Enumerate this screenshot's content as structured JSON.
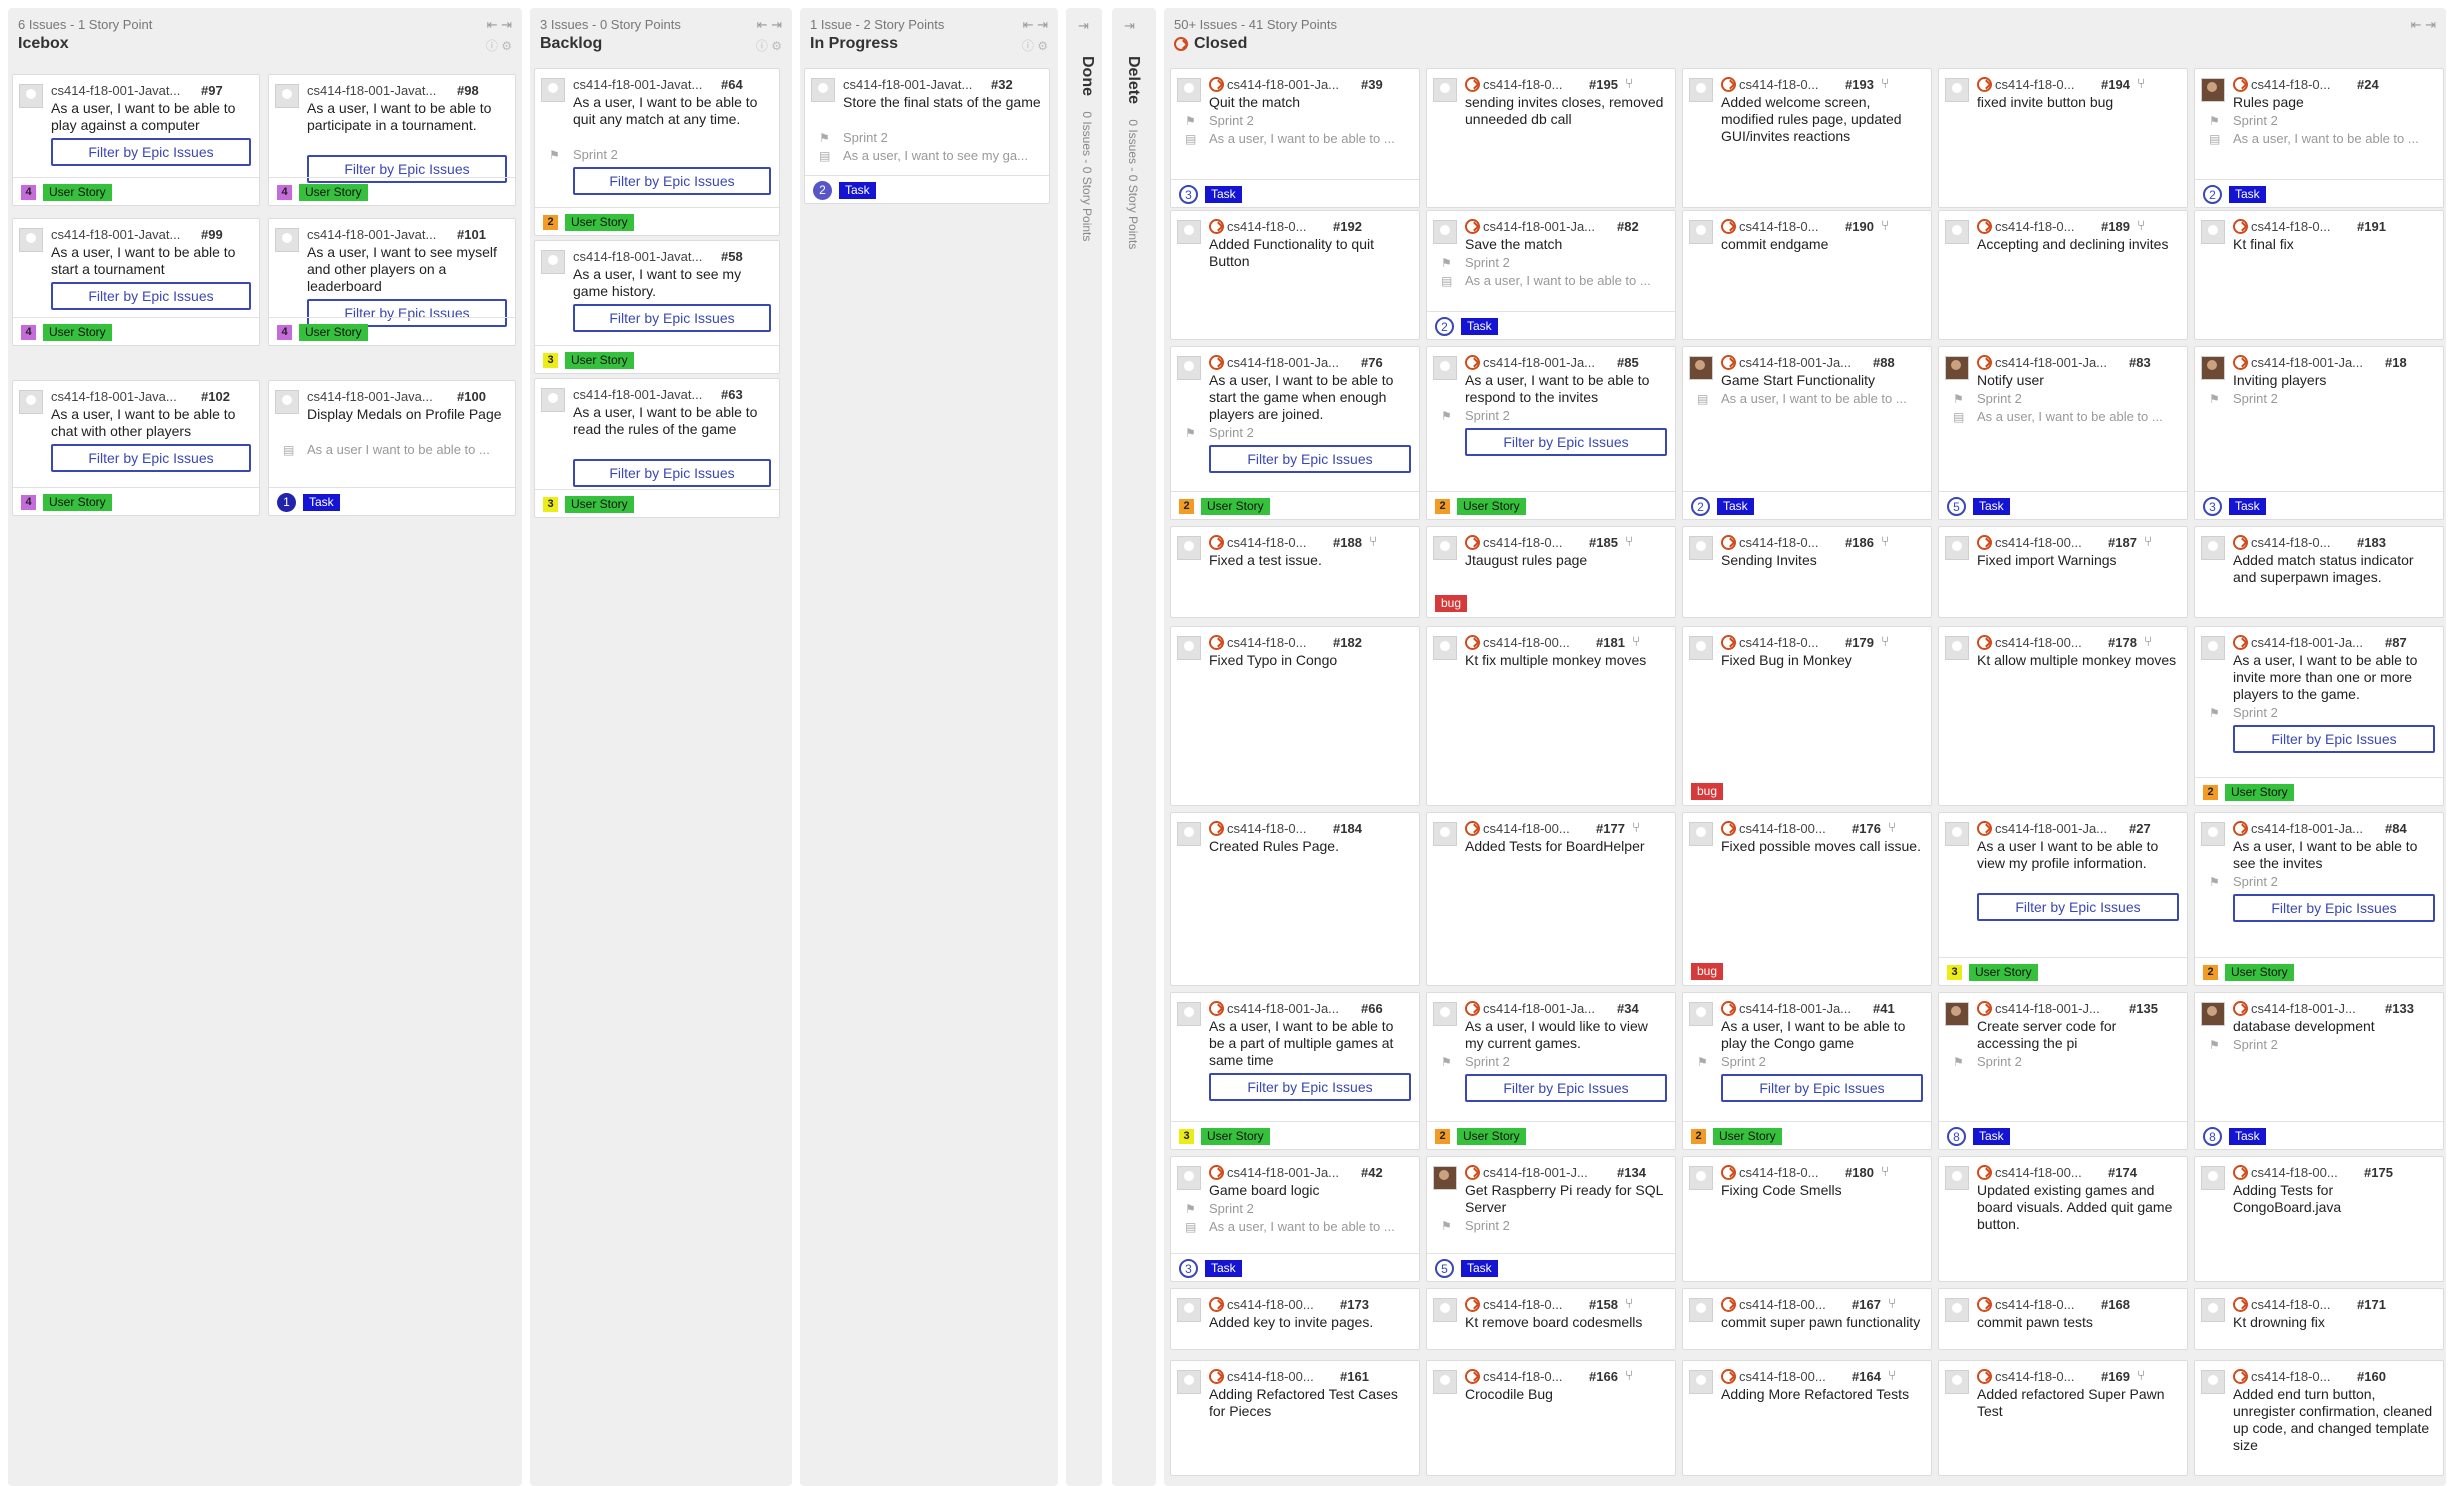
{
  "colors": {
    "user_story": "#35c13c",
    "task": "#1414d2",
    "bug": "#d73a3a",
    "est_purple": "#c56bdc",
    "est_orange": "#f29b25",
    "est_yellow": "#ecec19",
    "closed_icon": "#d04a1a",
    "epic_border": "#3a48b3"
  },
  "labels": {
    "user_story": "User Story",
    "task": "Task",
    "bug": "bug",
    "epic_btn": "Filter by Epic Issues",
    "sprint": "Sprint 2"
  },
  "icons": {
    "collapse": "collapse-icon",
    "expand": "expand-icon",
    "info": "info-icon",
    "settings": "gear-icon",
    "closed": "closed-issue-icon",
    "pull_request": "pull-request-icon",
    "milestone": "milestone-icon",
    "epic": "epic-icon"
  },
  "pipelines": [
    {
      "name": "Icebox",
      "meta": "6 Issues - 1 Story Point"
    },
    {
      "name": "Backlog",
      "meta": "3 Issues - 0 Story Points"
    },
    {
      "name": "In Progress",
      "meta": "1 Issue - 2 Story Points"
    },
    {
      "name": "Done",
      "meta": "0 Issues - 0 Story Points"
    },
    {
      "name": "Delete",
      "meta": "0 Issues - 0 Story Points"
    },
    {
      "name": "Closed",
      "meta": "50+ Issues - 41 Story Points"
    }
  ],
  "cards": [
    {
      "repo": "cs414-f18-001-Javat...",
      "num": "#97",
      "title": "As a user, I want to be able to play against a computer",
      "est": "4",
      "label": "User Story"
    },
    {
      "repo": "cs414-f18-001-Javat...",
      "num": "#98",
      "title": "As a user, I want to be able to participate in a tournament.",
      "est": "4",
      "label": "User Story"
    },
    {
      "repo": "cs414-f18-001-Javat...",
      "num": "#99",
      "title": "As a user, I want to be able to start a tournament",
      "est": "4",
      "label": "User Story"
    },
    {
      "repo": "cs414-f18-001-Javat...",
      "num": "#101",
      "title": "As a user, I want to see myself and other players on a leaderboard",
      "est": "4",
      "label": "User Story"
    },
    {
      "repo": "cs414-f18-001-Java...",
      "num": "#102",
      "title": "As a user, I want to be able to chat with other players",
      "est": "4",
      "label": "User Story"
    },
    {
      "repo": "cs414-f18-001-Java...",
      "num": "#100",
      "title": "Display Medals on Profile Page",
      "epicline": "As a user I want to be able to ...",
      "est": "1",
      "label": "Task"
    },
    {
      "repo": "cs414-f18-001-Javat...",
      "num": "#64",
      "title": "As a user, I want to be able to quit any match at any time.",
      "sprint": "Sprint 2",
      "est": "2",
      "label": "User Story"
    },
    {
      "repo": "cs414-f18-001-Javat...",
      "num": "#58",
      "title": "As a user, I want to see my game history.",
      "est": "3",
      "label": "User Story"
    },
    {
      "repo": "cs414-f18-001-Javat...",
      "num": "#63",
      "title": "As a user, I want to be able to read the rules of the game",
      "est": "3",
      "label": "User Story"
    },
    {
      "repo": "cs414-f18-001-Javat...",
      "num": "#32",
      "title": "Store the final stats of the game",
      "sprint": "Sprint 2",
      "epicline": "As a user, I want to see my ga...",
      "est": "2",
      "label": "Task"
    },
    {
      "repo": "cs414-f18-001-Ja...",
      "num": "#39",
      "title": "Quit the match",
      "sprint": "Sprint 2",
      "epicline": "As a user, I want to be able to ...",
      "est": "3",
      "label": "Task"
    },
    {
      "repo": "cs414-f18-0...",
      "num": "#195",
      "title": "sending invites closes, removed unneeded db call"
    },
    {
      "repo": "cs414-f18-0...",
      "num": "#193",
      "title": "Added welcome screen, modified rules page, updated GUI/invites reactions"
    },
    {
      "repo": "cs414-f18-0...",
      "num": "#194",
      "title": "fixed invite button bug"
    },
    {
      "repo": "cs414-f18-0...",
      "num": "#24",
      "title": "Rules page",
      "sprint": "Sprint 2",
      "epicline": "As a user, I want to be able to ...",
      "est": "2",
      "label": "Task"
    },
    {
      "repo": "cs414-f18-0...",
      "num": "#192",
      "title": "Added Functionality to quit Button"
    },
    {
      "repo": "cs414-f18-001-Ja...",
      "num": "#82",
      "title": "Save the match",
      "sprint": "Sprint 2",
      "epicline": "As a user, I want to be able to ...",
      "est": "2",
      "label": "Task"
    },
    {
      "repo": "cs414-f18-0...",
      "num": "#190",
      "title": "commit endgame"
    },
    {
      "repo": "cs414-f18-0...",
      "num": "#189",
      "title": "Accepting and declining invites"
    },
    {
      "repo": "cs414-f18-0...",
      "num": "#191",
      "title": "Kt final fix"
    },
    {
      "repo": "cs414-f18-001-Ja...",
      "num": "#76",
      "title": "As a user, I want to be able to start the game when enough players are joined.",
      "sprint": "Sprint 2",
      "est": "2",
      "label": "User Story"
    },
    {
      "repo": "cs414-f18-001-Ja...",
      "num": "#85",
      "title": "As a user, I want to be able to respond to the invites",
      "sprint": "Sprint 2",
      "est": "2",
      "label": "User Story"
    },
    {
      "repo": "cs414-f18-001-Ja...",
      "num": "#88",
      "title": "Game Start Functionality",
      "epicline": "As a user, I want to be able to ...",
      "est": "2",
      "label": "Task"
    },
    {
      "repo": "cs414-f18-001-Ja...",
      "num": "#83",
      "title": "Notify user",
      "sprint": "Sprint 2",
      "epicline": "As a user, I want to be able to ...",
      "est": "5",
      "label": "Task"
    },
    {
      "repo": "cs414-f18-001-Ja...",
      "num": "#18",
      "title": "Inviting players",
      "sprint": "Sprint 2",
      "est": "3",
      "label": "Task"
    },
    {
      "repo": "cs414-f18-0...",
      "num": "#188",
      "title": "Fixed a test issue."
    },
    {
      "repo": "cs414-f18-0...",
      "num": "#185",
      "title": "Jtaugust rules page",
      "label": "bug"
    },
    {
      "repo": "cs414-f18-0...",
      "num": "#186",
      "title": "Sending Invites"
    },
    {
      "repo": "cs414-f18-00...",
      "num": "#187",
      "title": "Fixed import Warnings"
    },
    {
      "repo": "cs414-f18-0...",
      "num": "#183",
      "title": "Added match status indicator and superpawn images."
    },
    {
      "repo": "cs414-f18-0...",
      "num": "#182",
      "title": "Fixed Typo in Congo"
    },
    {
      "repo": "cs414-f18-00...",
      "num": "#181",
      "title": "Kt fix multiple monkey moves"
    },
    {
      "repo": "cs414-f18-0...",
      "num": "#179",
      "title": "Fixed Bug in Monkey",
      "label": "bug"
    },
    {
      "repo": "cs414-f18-00...",
      "num": "#178",
      "title": "Kt allow multiple monkey moves"
    },
    {
      "repo": "cs414-f18-001-Ja...",
      "num": "#87",
      "title": "As a user, I want to be able to invite more than one or more players to the game.",
      "sprint": "Sprint 2",
      "est": "2",
      "label": "User Story"
    },
    {
      "repo": "cs414-f18-0...",
      "num": "#184",
      "title": "Created Rules Page."
    },
    {
      "repo": "cs414-f18-00...",
      "num": "#177",
      "title": "Added Tests for BoardHelper"
    },
    {
      "repo": "cs414-f18-00...",
      "num": "#176",
      "title": "Fixed possible moves call issue.",
      "label": "bug"
    },
    {
      "repo": "cs414-f18-001-Ja...",
      "num": "#27",
      "title": "As a user I want to be able to view my profile information.",
      "est": "3",
      "label": "User Story"
    },
    {
      "repo": "cs414-f18-001-Ja...",
      "num": "#84",
      "title": "As a user, I want to be able to see the invites",
      "sprint": "Sprint 2",
      "est": "2",
      "label": "User Story"
    },
    {
      "repo": "cs414-f18-001-Ja...",
      "num": "#66",
      "title": "As a user, I want to be able to be a part of multiple games at same time",
      "est": "3",
      "label": "User Story"
    },
    {
      "repo": "cs414-f18-001-Ja...",
      "num": "#34",
      "title": "As a user, I would like to view my current games.",
      "sprint": "Sprint 2",
      "est": "2",
      "label": "User Story"
    },
    {
      "repo": "cs414-f18-001-Ja...",
      "num": "#41",
      "title": "As a user, I want to be able to play the Congo game",
      "sprint": "Sprint 2",
      "est": "2",
      "label": "User Story"
    },
    {
      "repo": "cs414-f18-001-J...",
      "num": "#135",
      "title": "Create server code for accessing the pi",
      "sprint": "Sprint 2",
      "est": "8",
      "label": "Task"
    },
    {
      "repo": "cs414-f18-001-J...",
      "num": "#133",
      "title": "database development",
      "sprint": "Sprint 2",
      "est": "8",
      "label": "Task"
    },
    {
      "repo": "cs414-f18-001-Ja...",
      "num": "#42",
      "title": "Game board logic",
      "sprint": "Sprint 2",
      "epicline": "As a user, I want to be able to ...",
      "est": "3",
      "label": "Task"
    },
    {
      "repo": "cs414-f18-001-J...",
      "num": "#134",
      "title": "Get Raspberry Pi ready for SQL Server",
      "sprint": "Sprint 2",
      "est": "5",
      "label": "Task"
    },
    {
      "repo": "cs414-f18-0...",
      "num": "#180",
      "title": "Fixing Code Smells"
    },
    {
      "repo": "cs414-f18-00...",
      "num": "#174",
      "title": "Updated existing games and board visuals. Added quit game button."
    },
    {
      "repo": "cs414-f18-00...",
      "num": "#175",
      "title": "Adding Tests for CongoBoard.java"
    },
    {
      "repo": "cs414-f18-00...",
      "num": "#173",
      "title": "Added key to invite pages."
    },
    {
      "repo": "cs414-f18-0...",
      "num": "#158",
      "title": "Kt remove board codesmells"
    },
    {
      "repo": "cs414-f18-00...",
      "num": "#167",
      "title": "commit super pawn functionality"
    },
    {
      "repo": "cs414-f18-0...",
      "num": "#168",
      "title": "commit pawn tests"
    },
    {
      "repo": "cs414-f18-0...",
      "num": "#171",
      "title": "Kt drowning fix"
    },
    {
      "repo": "cs414-f18-00...",
      "num": "#161",
      "title": "Adding Refactored Test Cases for Pieces"
    },
    {
      "repo": "cs414-f18-0...",
      "num": "#166",
      "title": "Crocodile Bug"
    },
    {
      "repo": "cs414-f18-00...",
      "num": "#164",
      "title": "Adding More Refactored Tests"
    },
    {
      "repo": "cs414-f18-0...",
      "num": "#169",
      "title": "Added refactored Super Pawn Test"
    },
    {
      "repo": "cs414-f18-0...",
      "num": "#160",
      "title": "Added end turn button, unregister confirmation, cleaned up code, and changed template size"
    }
  ]
}
